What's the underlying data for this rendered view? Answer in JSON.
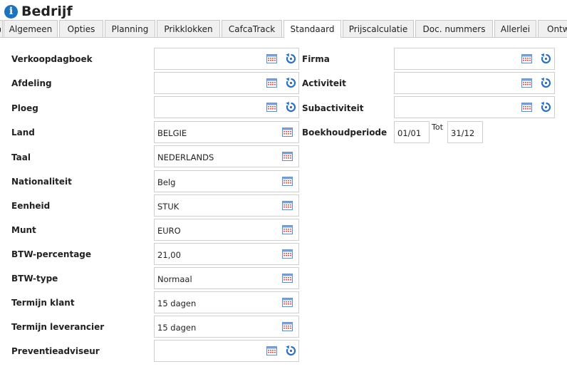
{
  "header": {
    "title": "Bedrijf",
    "icon": "info-icon"
  },
  "tabs": [
    {
      "label": "Algemeen"
    },
    {
      "label": "Opties"
    },
    {
      "label": "Planning"
    },
    {
      "label": "Prikklokken"
    },
    {
      "label": "CafcaTrack"
    },
    {
      "label": "Standaard",
      "active": true
    },
    {
      "label": "Prijscalculatie"
    },
    {
      "label": "Doc. nummers"
    },
    {
      "label": "Allerlei"
    },
    {
      "label": "Ontw"
    }
  ],
  "left": {
    "verkoopdagboek": {
      "label": "Verkoopdagboek",
      "value": ""
    },
    "afdeling": {
      "label": "Afdeling",
      "value": ""
    },
    "ploeg": {
      "label": "Ploeg",
      "value": ""
    },
    "land": {
      "label": "Land",
      "value": "BELGIE"
    },
    "taal": {
      "label": "Taal",
      "value": "NEDERLANDS"
    },
    "nationaliteit": {
      "label": "Nationaliteit",
      "value": "Belg"
    },
    "eenheid": {
      "label": "Eenheid",
      "value": "STUK"
    },
    "munt": {
      "label": "Munt",
      "value": "EURO"
    },
    "btw_percentage": {
      "label": "BTW-percentage",
      "value": "21,00"
    },
    "btw_type": {
      "label": "BTW-type",
      "value": "Normaal"
    },
    "termijn_klant": {
      "label": "Termijn klant",
      "value": "15 dagen"
    },
    "termijn_leverancier": {
      "label": "Termijn leverancier",
      "value": "15 dagen"
    },
    "preventieadviseur": {
      "label": "Preventieadviseur",
      "value": ""
    }
  },
  "right": {
    "firma": {
      "label": "Firma",
      "value": ""
    },
    "activiteit": {
      "label": "Activiteit",
      "value": ""
    },
    "subactiviteit": {
      "label": "Subactiviteit",
      "value": ""
    },
    "boekhoudperiode": {
      "label": "Boekhoudperiode",
      "from": "01/01",
      "tot_label": "Tot",
      "to": "31/12"
    }
  },
  "colors": {
    "info_blue": "#1e73be",
    "reset_blue": "#2a6fc0",
    "calendar_red": "#d9534f"
  }
}
